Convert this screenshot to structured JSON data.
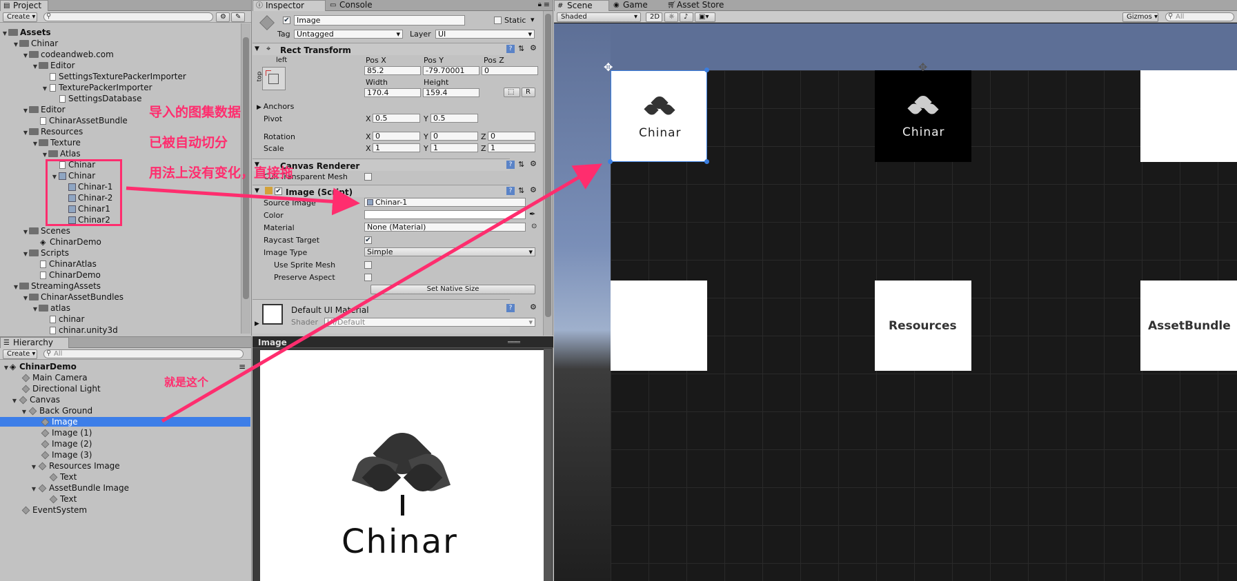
{
  "project": {
    "tab": "Project",
    "create": "Create",
    "search_placeholder": "",
    "items": [
      {
        "label": "Assets"
      },
      {
        "label": "Chinar"
      },
      {
        "label": "codeandweb.com"
      },
      {
        "label": "Editor"
      },
      {
        "label": "SettingsTexturePackerImporter"
      },
      {
        "label": "TexturePackerImporter"
      },
      {
        "label": "SettingsDatabase"
      },
      {
        "label": "Editor"
      },
      {
        "label": "ChinarAssetBundle"
      },
      {
        "label": "Resources"
      },
      {
        "label": "Texture"
      },
      {
        "label": "Atlas"
      },
      {
        "label": "Chinar"
      },
      {
        "label": "Chinar"
      },
      {
        "label": "Chinar-1"
      },
      {
        "label": "Chinar-2"
      },
      {
        "label": "Chinar1"
      },
      {
        "label": "Chinar2"
      },
      {
        "label": "Scenes"
      },
      {
        "label": "ChinarDemo"
      },
      {
        "label": "Scripts"
      },
      {
        "label": "ChinarAtlas"
      },
      {
        "label": "ChinarDemo"
      },
      {
        "label": "StreamingAssets"
      },
      {
        "label": "ChinarAssetBundles"
      },
      {
        "label": "atlas"
      },
      {
        "label": "chinar"
      },
      {
        "label": "chinar.unity3d"
      }
    ]
  },
  "hierarchy": {
    "tab": "Hierarchy",
    "create": "Create",
    "search": "All",
    "scene": "ChinarDemo",
    "items": [
      {
        "label": "Main Camera"
      },
      {
        "label": "Directional Light"
      },
      {
        "label": "Canvas"
      },
      {
        "label": "Back Ground"
      },
      {
        "label": "Image"
      },
      {
        "label": "Image (1)"
      },
      {
        "label": "Image (2)"
      },
      {
        "label": "Image (3)"
      },
      {
        "label": "Resources Image"
      },
      {
        "label": "Text"
      },
      {
        "label": "AssetBundle Image"
      },
      {
        "label": "Text"
      },
      {
        "label": "EventSystem"
      }
    ]
  },
  "inspector": {
    "tab_inspector": "Inspector",
    "tab_console": "Console",
    "name": "Image",
    "static": "Static",
    "tag_label": "Tag",
    "tag": "Untagged",
    "layer_label": "Layer",
    "layer": "UI",
    "rect": {
      "title": "Rect Transform",
      "anchor_h": "left",
      "anchor_v": "top",
      "posx_l": "Pos X",
      "posy_l": "Pos Y",
      "posz_l": "Pos Z",
      "posx": "85.2",
      "posy": "-79.70001",
      "posz": "0",
      "w_l": "Width",
      "h_l": "Height",
      "w": "170.4",
      "h": "159.4",
      "r": "R",
      "anchors": "Anchors",
      "pivot": "Pivot",
      "pivx": "0.5",
      "pivy": "0.5",
      "rotation": "Rotation",
      "rx": "0",
      "ry": "0",
      "rz": "0",
      "scale": "Scale",
      "sx": "1",
      "sy": "1",
      "sz": "1",
      "x": "X",
      "y": "Y",
      "z": "Z"
    },
    "canvas_renderer": "Canvas Renderer",
    "cull": "Cull Transparent Mesh",
    "cull_prefix": "",
    "image_script": "Image (Script)",
    "source_image_l": "Source Image",
    "source_image": "Chinar-1",
    "color_l": "Color",
    "material_l": "Material",
    "material": "None (Material)",
    "raycast_l": "Raycast Target",
    "image_type_l": "Image Type",
    "image_type": "Simple",
    "use_sprite_mesh": "Use Sprite Mesh",
    "preserve_aspect": "Preserve Aspect",
    "set_native": "Set Native Size",
    "default_mat": "Default UI Material",
    "shader_l": "Shader",
    "shader": "UI/Default",
    "preview_title": "Image",
    "preview_brand": "Chinar"
  },
  "scene": {
    "tab_scene": "Scene",
    "tab_game": "Game",
    "tab_store": "Asset Store",
    "shaded": "Shaded",
    "twod": "2D",
    "gizmos": "Gizmos",
    "search": "All",
    "brand1": "Chinar",
    "brand2": "Chinar",
    "resources": "Resources",
    "assetbundle": "AssetBundle"
  },
  "annotations": {
    "a1": "导入的图集数据",
    "a2": "已被自动切分",
    "a3": "用法上没有变化，直接拖",
    "a4": "就是这个"
  },
  "colors": {
    "accent": "#3d7ee8",
    "annotation": "#ff2d6e",
    "scene_bg": "#191919",
    "sky": "#5d6f96"
  }
}
